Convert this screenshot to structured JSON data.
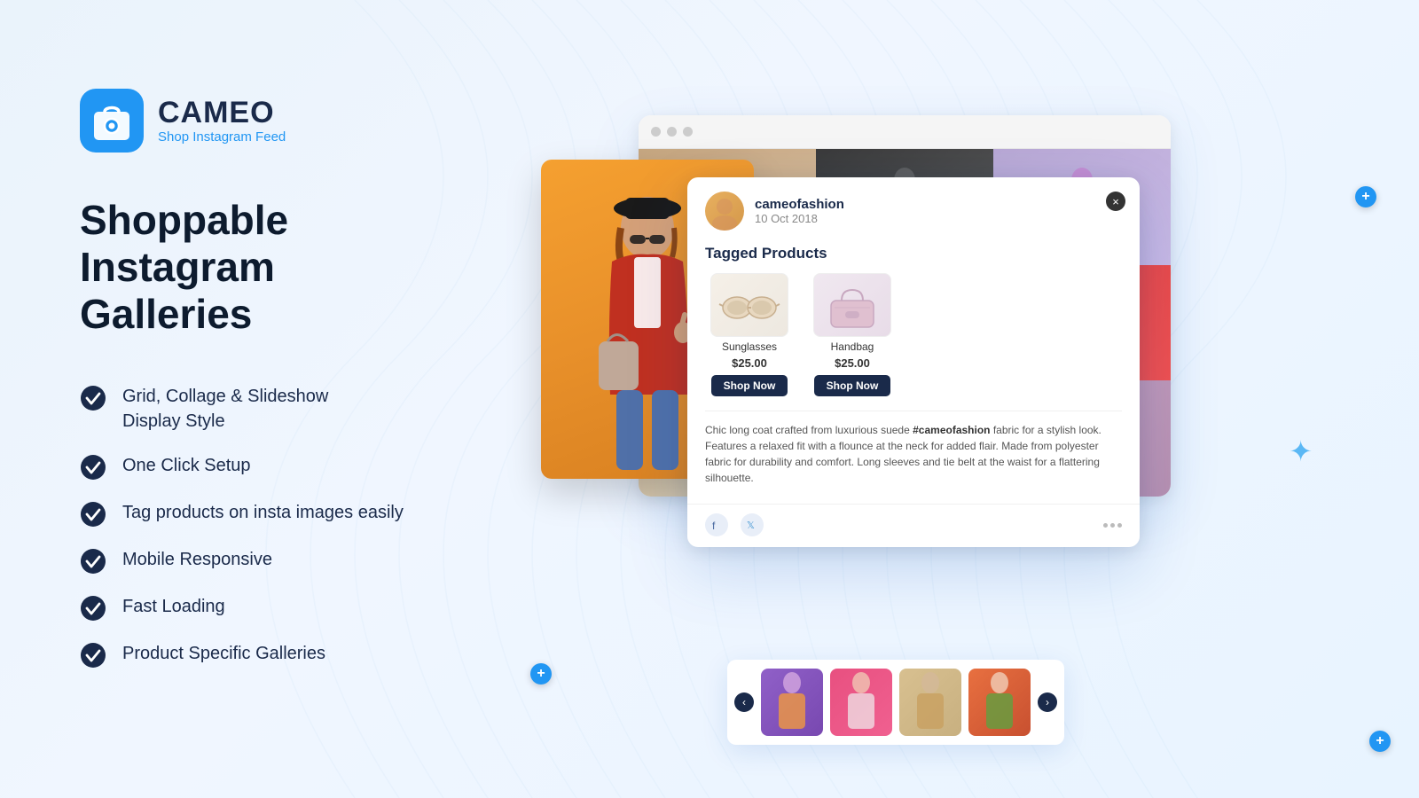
{
  "page": {
    "background": "#eaf3fb"
  },
  "logo": {
    "name": "CAMEO",
    "subtitle": "Shop Instagram Feed"
  },
  "hero": {
    "headline_line1": "Shoppable",
    "headline_line2": "Instagram Galleries"
  },
  "features": [
    {
      "id": 1,
      "text": "Grid, Collage & Slideshow Display Style"
    },
    {
      "id": 2,
      "text": "One Click Setup"
    },
    {
      "id": 3,
      "text": "Tag products on insta images easily"
    },
    {
      "id": 4,
      "text": "Mobile Responsive"
    },
    {
      "id": 5,
      "text": "Fast Loading"
    },
    {
      "id": 6,
      "text": "Product Specific Galleries"
    }
  ],
  "popup": {
    "username": "cameofashion",
    "date": "10 Oct 2018",
    "tagged_products_label": "Tagged Products",
    "close_label": "×",
    "products": [
      {
        "name": "Sunglasses",
        "price": "$25.00",
        "shop_label": "Shop Now"
      },
      {
        "name": "Handbag",
        "price": "$25.00",
        "shop_label": "Shop Now"
      }
    ],
    "description": "Chic long coat crafted from luxurious suede ",
    "description_hash": "#cameofashion",
    "description_rest": " fabric for a stylish look. Features a relaxed fit with a flounce at the neck for  added flair. Made from polyester fabric for durability and comfort. Long sleeves and tie belt at the waist for a flattering silhouette."
  },
  "slideshow": {
    "prev_label": "‹",
    "next_label": "›"
  },
  "browser": {
    "dots": [
      "●",
      "●",
      "●"
    ]
  }
}
